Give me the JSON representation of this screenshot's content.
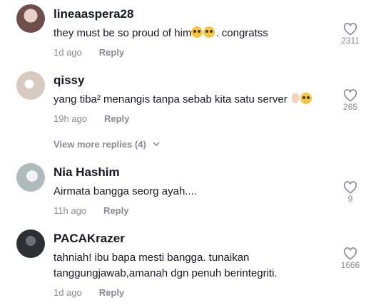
{
  "comments": [
    {
      "username": "lineaaspera28",
      "text": "they must be so proud of him",
      "text_suffix": ". congratss",
      "emojis": [
        "pleading-face-emoji",
        "pleading-face-emoji"
      ],
      "time": "1d ago",
      "reply_label": "Reply",
      "likes": "2311",
      "avatar_color": "#c9a7a0"
    },
    {
      "username": "qissy",
      "text": "yang tiba² menangis tanpa sebab kita satu server",
      "emojis": [
        "index-pointing-up-emoji",
        "pleading-face-emoji"
      ],
      "time": "19h ago",
      "reply_label": "Reply",
      "likes": "265",
      "avatar_color": "#d9cfc6"
    },
    {
      "username": "Nia Hashim",
      "text": "Airmata bangga seorg ayah....",
      "time": "11h ago",
      "reply_label": "Reply",
      "likes": "9",
      "avatar_color": "#b7c3c4"
    },
    {
      "username": "PACAKrazer",
      "text": "tahniah! ibu bapa mesti bangga. tunaikan tanggungjawab,amanah dgn penuh berintegriti.",
      "time": "1d ago",
      "reply_label": "Reply",
      "likes": "1666",
      "avatar_color": "#3b3f45"
    }
  ],
  "view_more_replies": "View more replies (4)",
  "icons": {
    "like": "heart-outline-icon",
    "expand": "chevron-down-icon"
  }
}
